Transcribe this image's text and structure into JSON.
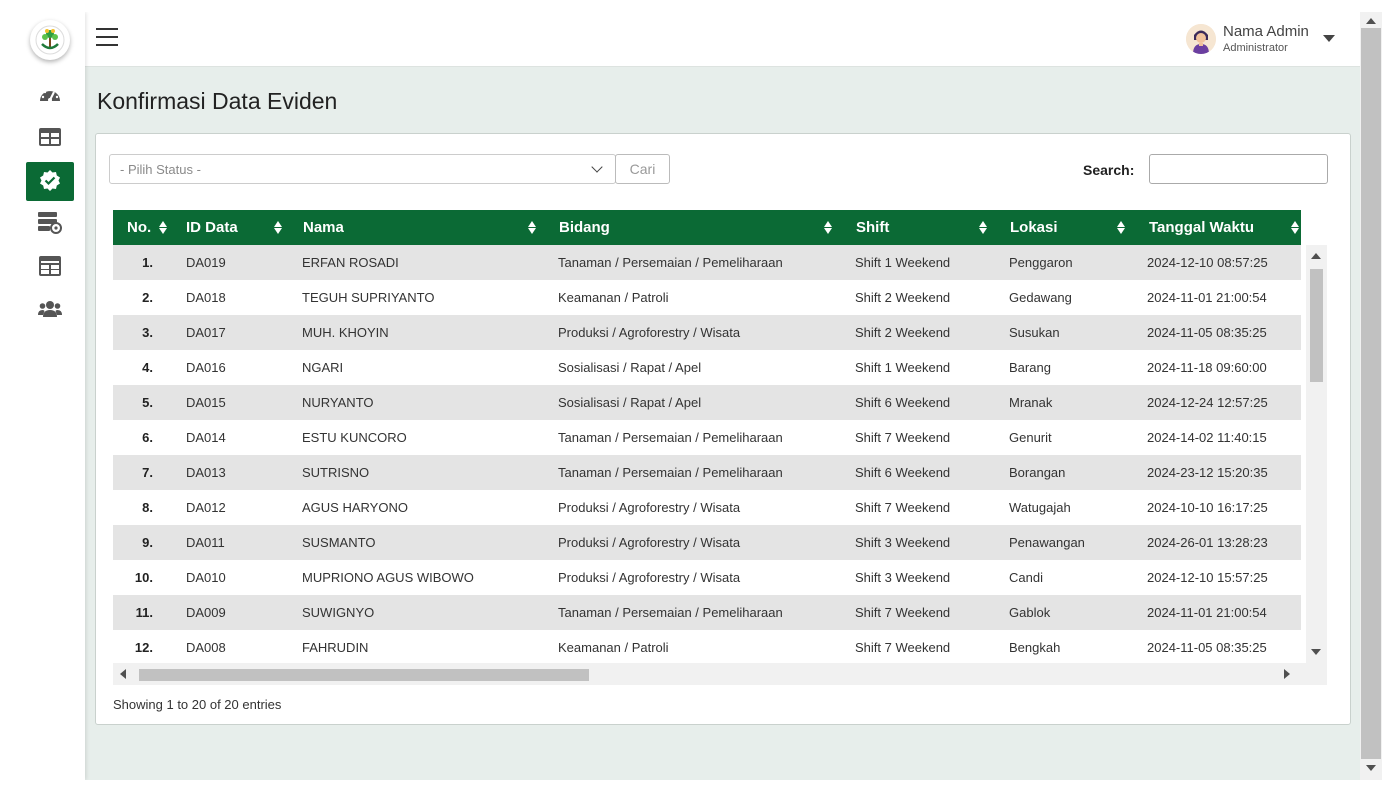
{
  "header": {
    "menu_icon": "hamburger-icon",
    "user": {
      "name": "Nama Admin",
      "role": "Administrator",
      "avatar_icon": "avatar-icon"
    }
  },
  "sidebar": {
    "logo_icon": "leaf-logo-icon",
    "items": [
      {
        "icon": "dashboard-icon",
        "active": false
      },
      {
        "icon": "table-icon",
        "active": false
      },
      {
        "icon": "verified-check-icon",
        "active": true
      },
      {
        "icon": "server-settings-icon",
        "active": false
      },
      {
        "icon": "calendar-table-icon",
        "active": false
      },
      {
        "icon": "users-icon",
        "active": false
      }
    ]
  },
  "page": {
    "title": "Konfirmasi Data Eviden"
  },
  "filters": {
    "status_placeholder": "- Pilih Status -",
    "cari_label": "Cari",
    "search_label": "Search:"
  },
  "table": {
    "columns": [
      "No.",
      "ID Data",
      "Nama",
      "Bidang",
      "Shift",
      "Lokasi",
      "Tanggal Waktu"
    ],
    "rows": [
      [
        "1.",
        "DA019",
        "ERFAN ROSADI",
        "Tanaman / Persemaian / Pemeliharaan",
        "Shift 1 Weekend",
        "Penggaron",
        "2024-12-10 08:57:25"
      ],
      [
        "2.",
        "DA018",
        "TEGUH SUPRIYANTO",
        "Keamanan / Patroli",
        "Shift 2 Weekend",
        "Gedawang",
        "2024-11-01 21:00:54"
      ],
      [
        "3.",
        "DA017",
        "MUH. KHOYIN",
        "Produksi / Agroforestry / Wisata",
        "Shift 2 Weekend",
        "Susukan",
        "2024-11-05 08:35:25"
      ],
      [
        "4.",
        "DA016",
        "NGARI",
        "Sosialisasi / Rapat / Apel",
        "Shift 1 Weekend",
        "Barang",
        "2024-11-18 09:60:00"
      ],
      [
        "5.",
        "DA015",
        "NURYANTO",
        "Sosialisasi / Rapat / Apel",
        "Shift 6 Weekend",
        "Mranak",
        "2024-12-24 12:57:25"
      ],
      [
        "6.",
        "DA014",
        "ESTU KUNCORO",
        "Tanaman / Persemaian / Pemeliharaan",
        "Shift 7 Weekend",
        "Genurit",
        "2024-14-02 11:40:15"
      ],
      [
        "7.",
        "DA013",
        "SUTRISNO",
        "Tanaman / Persemaian / Pemeliharaan",
        "Shift 6 Weekend",
        "Borangan",
        "2024-23-12 15:20:35"
      ],
      [
        "8.",
        "DA012",
        "AGUS HARYONO",
        "Produksi / Agroforestry / Wisata",
        "Shift 7 Weekend",
        "Watugajah",
        "2024-10-10 16:17:25"
      ],
      [
        "9.",
        "DA011",
        "SUSMANTO",
        "Produksi / Agroforestry / Wisata",
        "Shift 3 Weekend",
        "Penawangan",
        "2024-26-01 13:28:23"
      ],
      [
        "10.",
        "DA010",
        "MUPRIONO AGUS WIBOWO",
        "Produksi / Agroforestry / Wisata",
        "Shift 3 Weekend",
        "Candi",
        "2024-12-10 15:57:25"
      ],
      [
        "11.",
        "DA009",
        "SUWIGNYO",
        "Tanaman / Persemaian / Pemeliharaan",
        "Shift 7 Weekend",
        "Gablok",
        "2024-11-01 21:00:54"
      ],
      [
        "12.",
        "DA008",
        "FAHRUDIN",
        "Keamanan / Patroli",
        "Shift 7 Weekend",
        "Bengkah",
        "2024-11-05 08:35:25"
      ]
    ]
  },
  "footer": {
    "info": "Showing 1 to 20 of 20 entries"
  },
  "colors": {
    "primary": "#0b6a35",
    "background": "#e7eeeb",
    "row_alt": "#e4e4e4"
  }
}
